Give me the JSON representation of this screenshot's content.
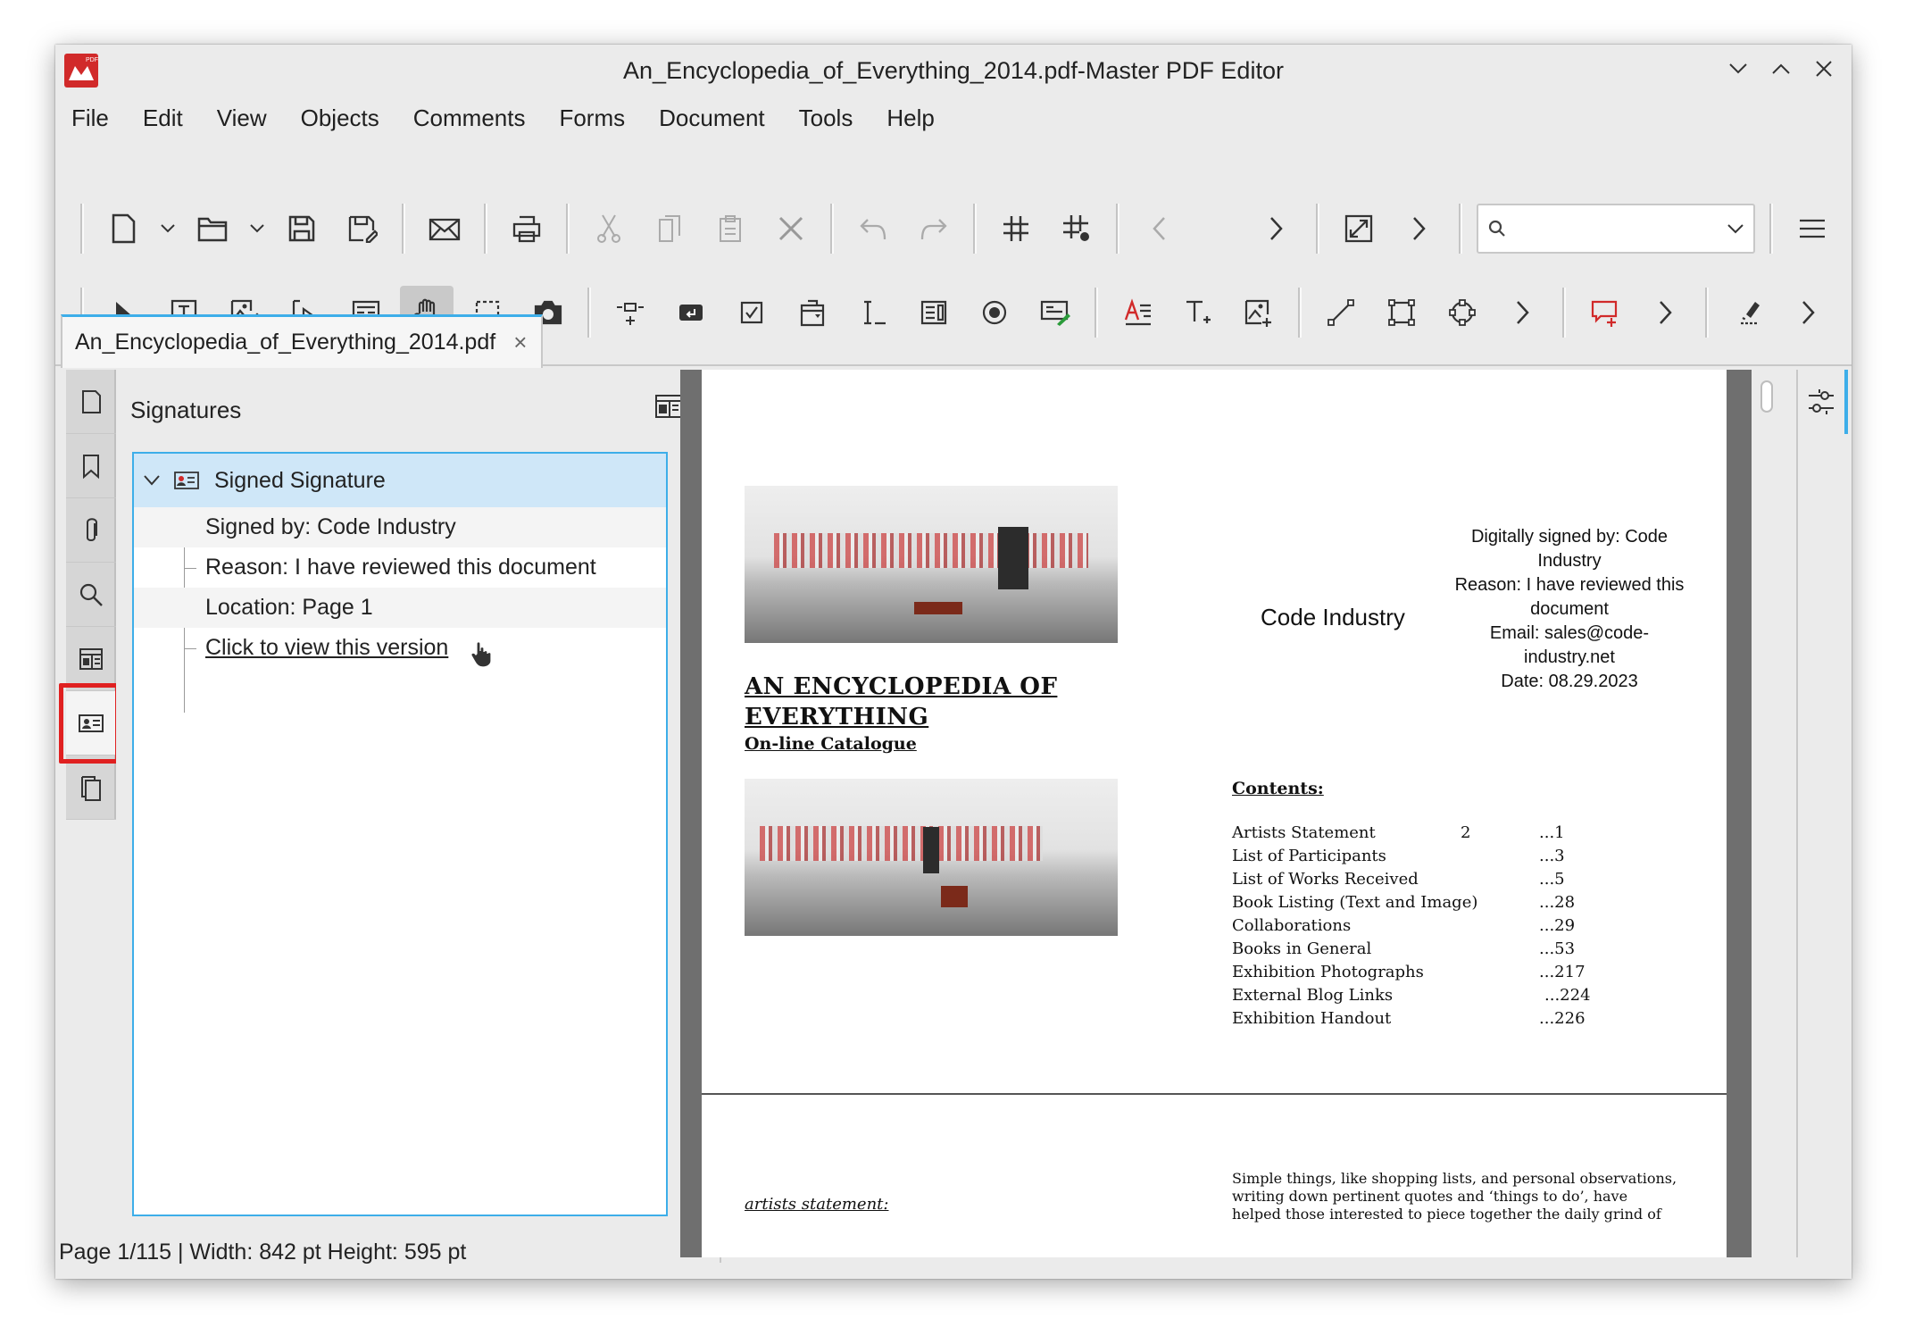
{
  "window": {
    "title": "An_Encyclopedia_of_Everything_2014.pdf-Master PDF Editor",
    "app_logo_text": "PDF"
  },
  "menu": [
    "File",
    "Edit",
    "View",
    "Objects",
    "Comments",
    "Forms",
    "Document",
    "Tools",
    "Help"
  ],
  "toolbar": {
    "search_placeholder": "",
    "search_value": ""
  },
  "tab": {
    "label": "An_Encyclopedia_of_Everything_2014.pdf",
    "close": "×"
  },
  "signatures_panel": {
    "title": "Signatures",
    "signature": {
      "label": "Signed Signature",
      "signed_by": "Signed by: Code Industry",
      "reason": "Reason: I have reviewed this document",
      "location": "Location: Page 1",
      "view_version": "Click to view this version"
    }
  },
  "pdf": {
    "heading_line1": "AN ENCYCLOPEDIA OF",
    "heading_line2": "EVERYTHING",
    "subheading": "On-line Catalogue",
    "signer_name": "Code Industry",
    "signature_details": [
      "Digitally signed by: Code",
      "Industry",
      "Reason: I have reviewed this",
      "document",
      "Email: sales@code-",
      "industry.net",
      "Date: 08.29.2023"
    ],
    "contents_title": "Contents:",
    "contents": [
      {
        "title": "Artists Statement",
        "mid": "2",
        "page": "...1"
      },
      {
        "title": "List of Participants",
        "mid": "",
        "page": "...3"
      },
      {
        "title": "List of Works Received",
        "mid": "",
        "page": "...5"
      },
      {
        "title": "Book Listing (Text and Image)",
        "mid": "",
        "page": "...28"
      },
      {
        "title": "Collaborations",
        "mid": "",
        "page": "...29"
      },
      {
        "title": "Books in General",
        "mid": "",
        "page": "...53"
      },
      {
        "title": "Exhibition Photographs",
        "mid": "",
        "page": "...217"
      },
      {
        "title": "External Blog Links",
        "mid": "",
        "page": "...224"
      },
      {
        "title": "Exhibition Handout",
        "mid": "",
        "page": "...226"
      }
    ],
    "artists_statement": "artists statement:",
    "simple_text_line1": "Simple things, like shopping lists, and personal observations,",
    "simple_text_line2": "writing down pertinent quotes and  ‘things    to do’, have",
    "simple_text_line3": "helped those interested to piece together the daily grind of"
  },
  "statusbar": {
    "text": "Page 1/115 | Width: 842 pt Height: 595 pt"
  },
  "colors": {
    "accent": "#3daee9",
    "highlight_red": "#e02020",
    "selection_bg": "#cfe7f8",
    "window_bg": "#ebebeb"
  }
}
